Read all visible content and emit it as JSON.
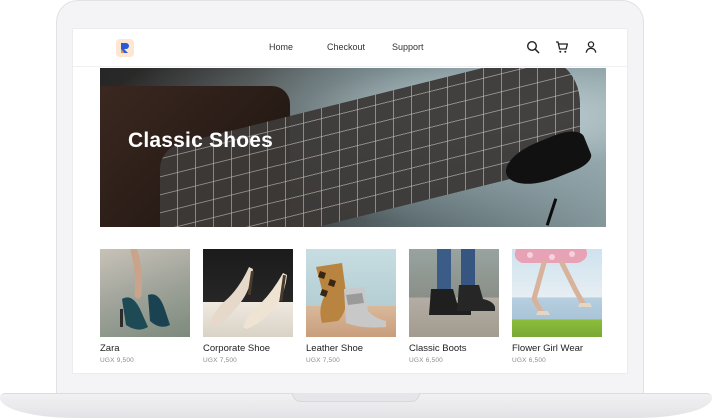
{
  "nav": {
    "links": [
      "Home",
      "Checkout",
      "Support"
    ]
  },
  "icons": {
    "logo": "brand-logo-icon",
    "search": "search-icon",
    "cart": "cart-icon",
    "user": "user-icon"
  },
  "hero": {
    "title": "Classic Shoes"
  },
  "products": [
    {
      "name": "Zara",
      "price": "UGX 9,500"
    },
    {
      "name": "Corporate Shoe",
      "price": "UGX 7,500"
    },
    {
      "name": "Leather Shoe",
      "price": "UGX 7,500"
    },
    {
      "name": "Classic Boots",
      "price": "UGX 6,500"
    },
    {
      "name": "Flower Girl Wear",
      "price": "UGX 6,500"
    }
  ],
  "colors": {
    "logo_bg": "#fde7d3",
    "logo_blue": "#2a5bd7",
    "logo_orange": "#f08a3c"
  }
}
